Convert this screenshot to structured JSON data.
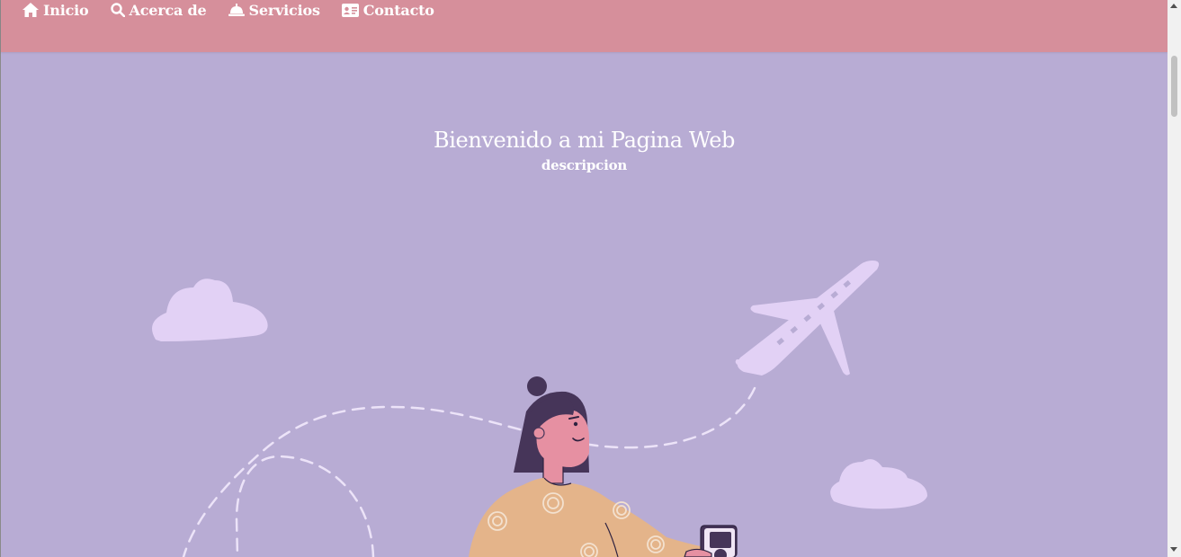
{
  "nav": {
    "items": [
      {
        "label": "Inicio",
        "icon": "home-icon"
      },
      {
        "label": "Acerca de",
        "icon": "search-icon"
      },
      {
        "label": "Servicios",
        "icon": "service-bell-icon"
      },
      {
        "label": "Contacto",
        "icon": "id-card-icon"
      }
    ]
  },
  "hero": {
    "title": "Bienvenido a mi Pagina Web",
    "subtitle": "descripcion"
  },
  "colors": {
    "navbar": "#d68f9b",
    "background": "#b8acd4",
    "accent_light": "#e2d1f5",
    "hair": "#463559",
    "skin": "#e690a2",
    "sweater": "#e4b48a"
  }
}
